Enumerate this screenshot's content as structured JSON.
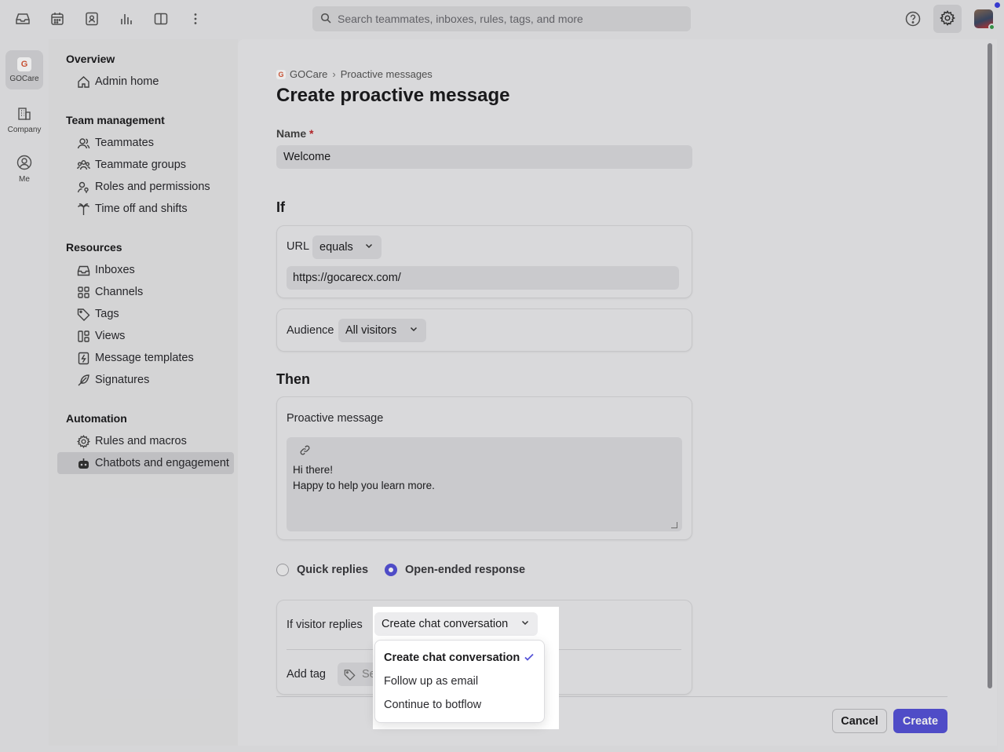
{
  "topbar": {
    "search_placeholder": "Search teammates, inboxes, rules, tags, and more",
    "icons": [
      "inbox-icon",
      "calendar-icon",
      "contacts-icon",
      "analytics-icon",
      "split-view-icon",
      "more-icon",
      "help-icon",
      "settings-icon"
    ]
  },
  "rail": {
    "items": [
      {
        "label": "GOCare",
        "badge": "G"
      },
      {
        "label": "Company"
      },
      {
        "label": "Me"
      }
    ]
  },
  "sidebar": {
    "sections": [
      {
        "title": "Overview",
        "items": [
          "Admin home"
        ]
      },
      {
        "title": "Team management",
        "items": [
          "Teammates",
          "Teammate groups",
          "Roles and permissions",
          "Time off and shifts"
        ]
      },
      {
        "title": "Resources",
        "items": [
          "Inboxes",
          "Channels",
          "Tags",
          "Views",
          "Message templates",
          "Signatures"
        ]
      },
      {
        "title": "Automation",
        "items": [
          "Rules and macros",
          "Chatbots and engagement"
        ]
      }
    ],
    "active_item": "Chatbots and engagement"
  },
  "breadcrumb": {
    "badge": "G",
    "workspace": "GOCare",
    "sep": "›",
    "current": "Proactive messages"
  },
  "page_title": "Create proactive message",
  "name_field": {
    "label": "Name",
    "required_mark": "*",
    "value": "Welcome"
  },
  "if_section": {
    "heading": "If",
    "url_label": "URL",
    "url_operator": "equals",
    "url_value": "https://gocarecx.com/",
    "audience_label": "Audience",
    "audience_value": "All visitors"
  },
  "then_section": {
    "heading": "Then",
    "message_label": "Proactive message",
    "message_lines": [
      "Hi there!",
      "Happy to help you learn more."
    ]
  },
  "response_type": {
    "options": [
      "Quick replies",
      "Open-ended response"
    ],
    "selected": "Open-ended response"
  },
  "visitor_reply": {
    "label": "If visitor replies",
    "selected": "Create chat conversation",
    "options": [
      "Create chat conversation",
      "Follow up as email",
      "Continue to botflow"
    ],
    "tag_label": "Add tag",
    "tag_placeholder": "Se"
  },
  "footer": {
    "cancel": "Cancel",
    "create": "Create"
  },
  "colors": {
    "accent": "#5653d8",
    "required": "#c0282c",
    "brand_badge": "#d85a3a"
  }
}
